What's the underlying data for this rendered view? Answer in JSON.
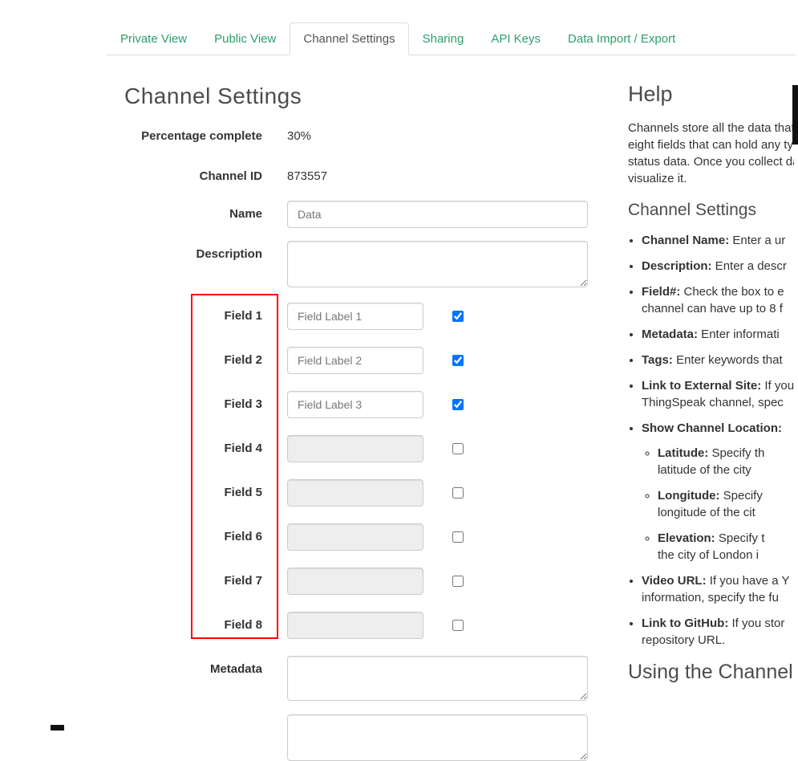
{
  "tabs": [
    {
      "label": "Private View"
    },
    {
      "label": "Public View"
    },
    {
      "label": "Channel Settings"
    },
    {
      "label": "Sharing"
    },
    {
      "label": "API Keys"
    },
    {
      "label": "Data Import / Export"
    }
  ],
  "page": {
    "title": "Channel Settings"
  },
  "form": {
    "percentage_label": "Percentage complete",
    "percentage_value": "30%",
    "channel_id_label": "Channel ID",
    "channel_id_value": "873557",
    "name_label": "Name",
    "name_value": "Data",
    "description_label": "Description",
    "metadata_label": "Metadata",
    "fields": [
      {
        "label": "Field 1",
        "value": "Field Label 1",
        "checked": "checked"
      },
      {
        "label": "Field 2",
        "value": "Field Label 2",
        "checked": "checked"
      },
      {
        "label": "Field 3",
        "value": "Field Label 3",
        "checked": "checked"
      },
      {
        "label": "Field 4",
        "value": "",
        "disabled": "disabled"
      },
      {
        "label": "Field 5",
        "value": "",
        "disabled": "disabled"
      },
      {
        "label": "Field 6",
        "value": "",
        "disabled": "disabled"
      },
      {
        "label": "Field 7",
        "value": "",
        "disabled": "disabled"
      },
      {
        "label": "Field 8",
        "value": "",
        "disabled": "disabled"
      }
    ]
  },
  "help": {
    "title": "Help",
    "intro_lines": [
      "Channels store all the data that a",
      "eight fields that can hold any typ",
      "status data. Once you collect dat",
      "visualize it."
    ],
    "settings_title": "Channel Settings",
    "items": [
      {
        "b": "Channel Name:",
        "l1": " Enter a ur"
      },
      {
        "b": "Description:",
        "l1": " Enter a descr"
      },
      {
        "b": "Field#:",
        "l1": " Check the box to e",
        "l2": "channel can have up to 8 f"
      },
      {
        "b": "Metadata:",
        "l1": " Enter informati"
      },
      {
        "b": "Tags:",
        "l1": " Enter keywords that"
      },
      {
        "b": "Link to External Site:",
        "l1": " If you",
        "l2": "ThingSpeak channel, spec"
      },
      {
        "b": "Show Channel Location:",
        "l1": ""
      },
      {
        "b": "Video URL:",
        "l1": " If you have a Y",
        "l2": "information, specify the fu"
      },
      {
        "b": "Link to GitHub:",
        "l1": " If you stor",
        "l2": "repository URL."
      }
    ],
    "location_items": [
      {
        "b": "Latitude:",
        "l1": " Specify th",
        "l2": "latitude of the city"
      },
      {
        "b": "Longitude:",
        "l1": " Specify",
        "l2": "longitude of the cit"
      },
      {
        "b": "Elevation:",
        "l1": " Specify t",
        "l2": "the city of London i"
      }
    ],
    "using_title": "Using the Channel"
  }
}
